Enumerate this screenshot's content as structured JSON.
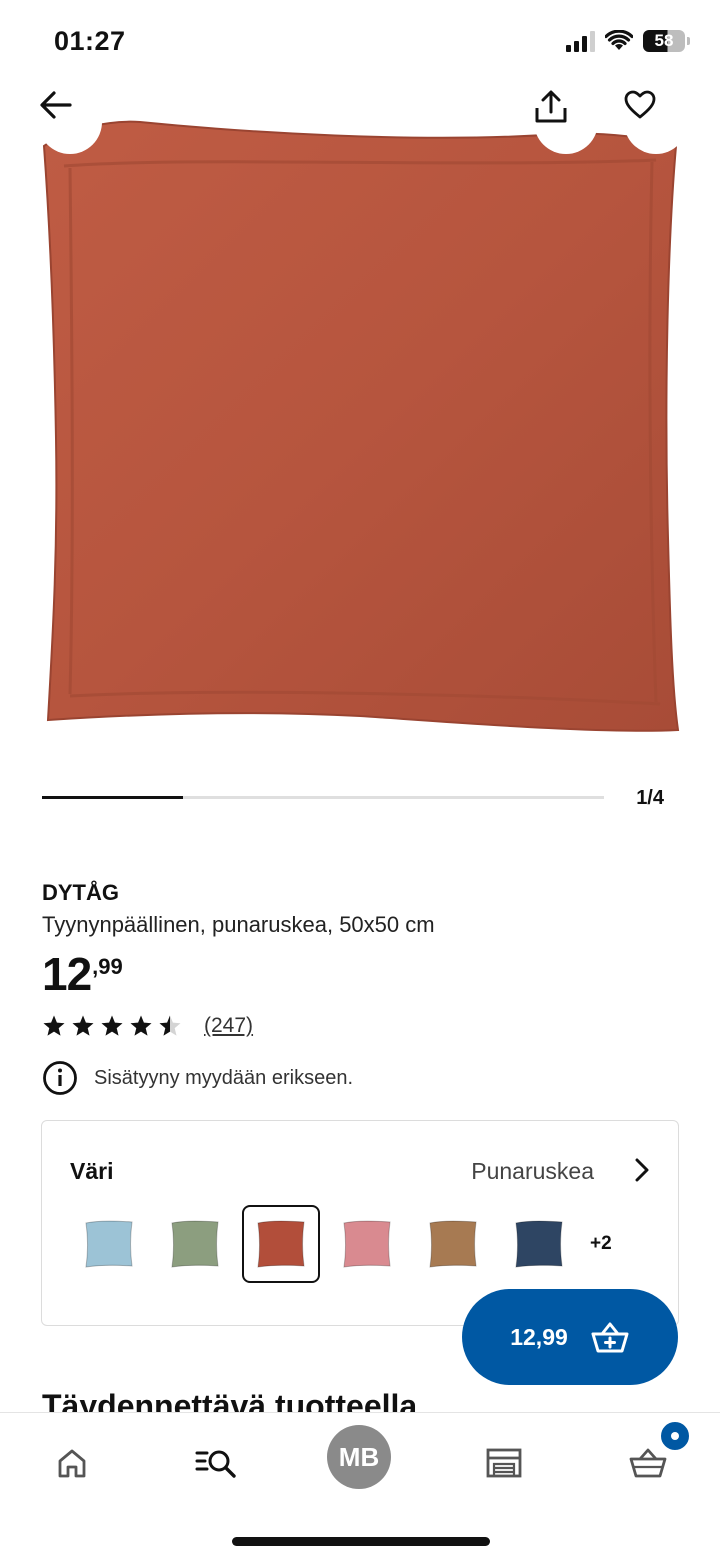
{
  "status_bar": {
    "time": "01:27",
    "battery": "58"
  },
  "hero": {
    "image_name": "DYTÅG cushion cover red-brown",
    "pillow_color": "#b6553e",
    "progress_fraction": 0.25,
    "page_counter": "1/4"
  },
  "product": {
    "brand": "DYTÅG",
    "description": "Tyynynpäällinen, punaruskea, 50x50 cm",
    "price_integer": "12",
    "price_decimals": ",99",
    "rating": 4.5,
    "review_count": "(247)",
    "info_note": "Sisätyyny myydään erikseen."
  },
  "color_selector": {
    "label": "Väri",
    "selected_value": "Punaruskea",
    "swatches": [
      {
        "name": "light-blue",
        "color": "#9cc3d6"
      },
      {
        "name": "green",
        "color": "#8c9e7f"
      },
      {
        "name": "red-brown",
        "color": "#b24e3a",
        "selected": true
      },
      {
        "name": "pink",
        "color": "#d98a90"
      },
      {
        "name": "brown",
        "color": "#a77a52"
      },
      {
        "name": "dark-blue",
        "color": "#2e4563"
      }
    ],
    "more_count": "+2"
  },
  "cart_button": {
    "price": "12,99",
    "color": "#0058a3"
  },
  "section": {
    "heading": "Täydennettävä tuotteella"
  },
  "bottom_nav": {
    "items": [
      "home-icon",
      "search-list-icon",
      "profile-avatar",
      "stores-icon",
      "cart-icon"
    ],
    "profile_initials": "MB"
  }
}
